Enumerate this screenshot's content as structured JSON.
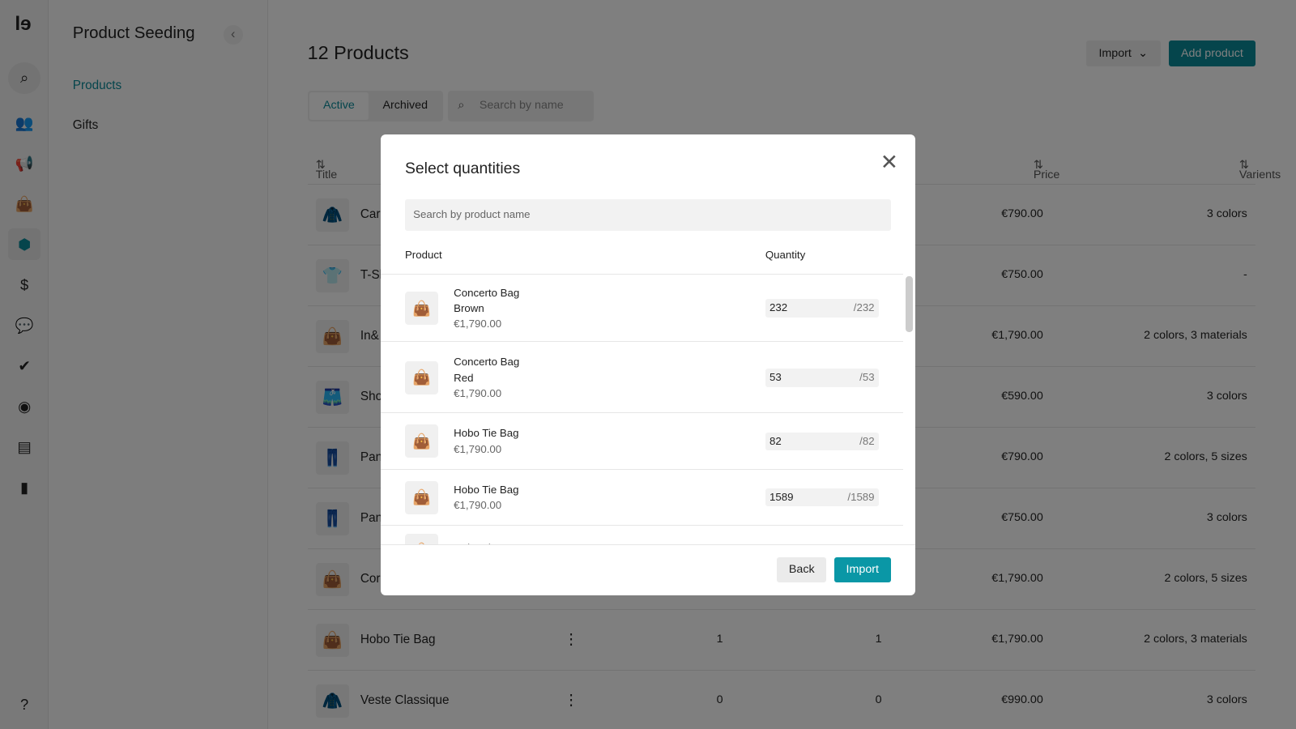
{
  "rail": {
    "icons": [
      "search-icon",
      "users-icon",
      "megaphone-icon",
      "bag-icon",
      "box-icon",
      "dollar-icon",
      "chat-icon",
      "user-check-icon",
      "compass-icon",
      "card-icon",
      "chart-icon",
      "help-icon"
    ],
    "accent": "#0a8a99",
    "logo": "le"
  },
  "sidebar": {
    "title": "Product Seeding",
    "items": [
      {
        "label": "Products"
      },
      {
        "label": "Gifts"
      }
    ]
  },
  "page": {
    "title": "12 Products",
    "import_label": "Import",
    "add_label": "Add product",
    "tabs": [
      "Active",
      "Archived"
    ],
    "search_placeholder": "Search by name",
    "columns": {
      "title": "Title",
      "price": "Price",
      "variants": "Varients"
    },
    "rows": [
      {
        "title": "Car",
        "c1": "",
        "c2": "",
        "price": "€790.00",
        "variants": "3 colors"
      },
      {
        "title": "T-Sh",
        "c1": "",
        "c2": "",
        "price": "€750.00",
        "variants": "-"
      },
      {
        "title": "In&",
        "c1": "",
        "c2": "",
        "price": "€1,790.00",
        "variants": "2 colors, 3 materials"
      },
      {
        "title": "Sho",
        "c1": "",
        "c2": "",
        "price": "€590.00",
        "variants": "3 colors"
      },
      {
        "title": "Pan",
        "c1": "",
        "c2": "",
        "price": "€790.00",
        "variants": "2 colors, 5 sizes"
      },
      {
        "title": "Pan",
        "c1": "",
        "c2": "",
        "price": "€750.00",
        "variants": "3 colors"
      },
      {
        "title": "Cor",
        "c1": "",
        "c2": "",
        "price": "€1,790.00",
        "variants": "2 colors, 5 sizes"
      },
      {
        "title": "Hobo Tie Bag",
        "c1": "1",
        "c2": "1",
        "price": "€1,790.00",
        "variants": "2 colors, 3 materials"
      },
      {
        "title": "Veste Classique",
        "c1": "0",
        "c2": "0",
        "price": "€990.00",
        "variants": "3 colors"
      }
    ]
  },
  "modal": {
    "title": "Select quantities",
    "search_placeholder": "Search by product name",
    "col_product": "Product",
    "col_quantity": "Quantity",
    "back_label": "Back",
    "import_label": "Import",
    "items": [
      {
        "name": "Concerto Bag",
        "variant": "Brown",
        "price": "€1,790.00",
        "qty": "232",
        "max": "/232"
      },
      {
        "name": "Concerto Bag",
        "variant": "Red",
        "price": "€1,790.00",
        "qty": "53",
        "max": "/53"
      },
      {
        "name": "Hobo Tie Bag",
        "variant": "",
        "price": "€1,790.00",
        "qty": "82",
        "max": "/82"
      },
      {
        "name": "Hobo Tie Bag",
        "variant": "",
        "price": "€1,790.00",
        "qty": "1589",
        "max": "/1589"
      },
      {
        "name": "Hobo Tie Bag",
        "variant": "",
        "price": "",
        "qty": "",
        "max": ""
      }
    ]
  }
}
